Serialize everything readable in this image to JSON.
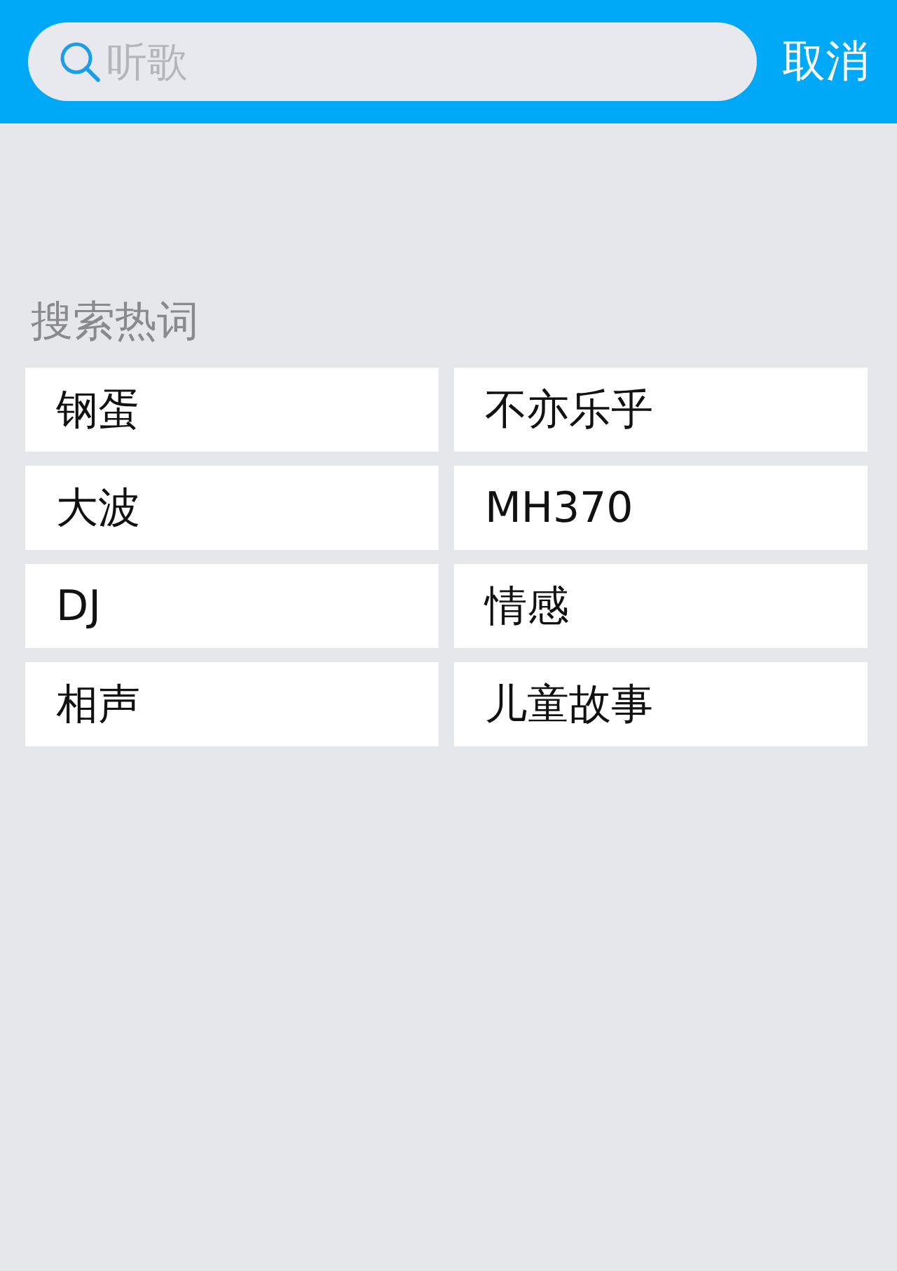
{
  "search": {
    "placeholder": "听歌"
  },
  "cancel_button": "取消",
  "hot_words": {
    "title": "搜索热词",
    "items": [
      "钢蛋",
      "不亦乐乎",
      "大波",
      "MH370",
      "DJ",
      "情感",
      "相声",
      "儿童故事"
    ]
  }
}
